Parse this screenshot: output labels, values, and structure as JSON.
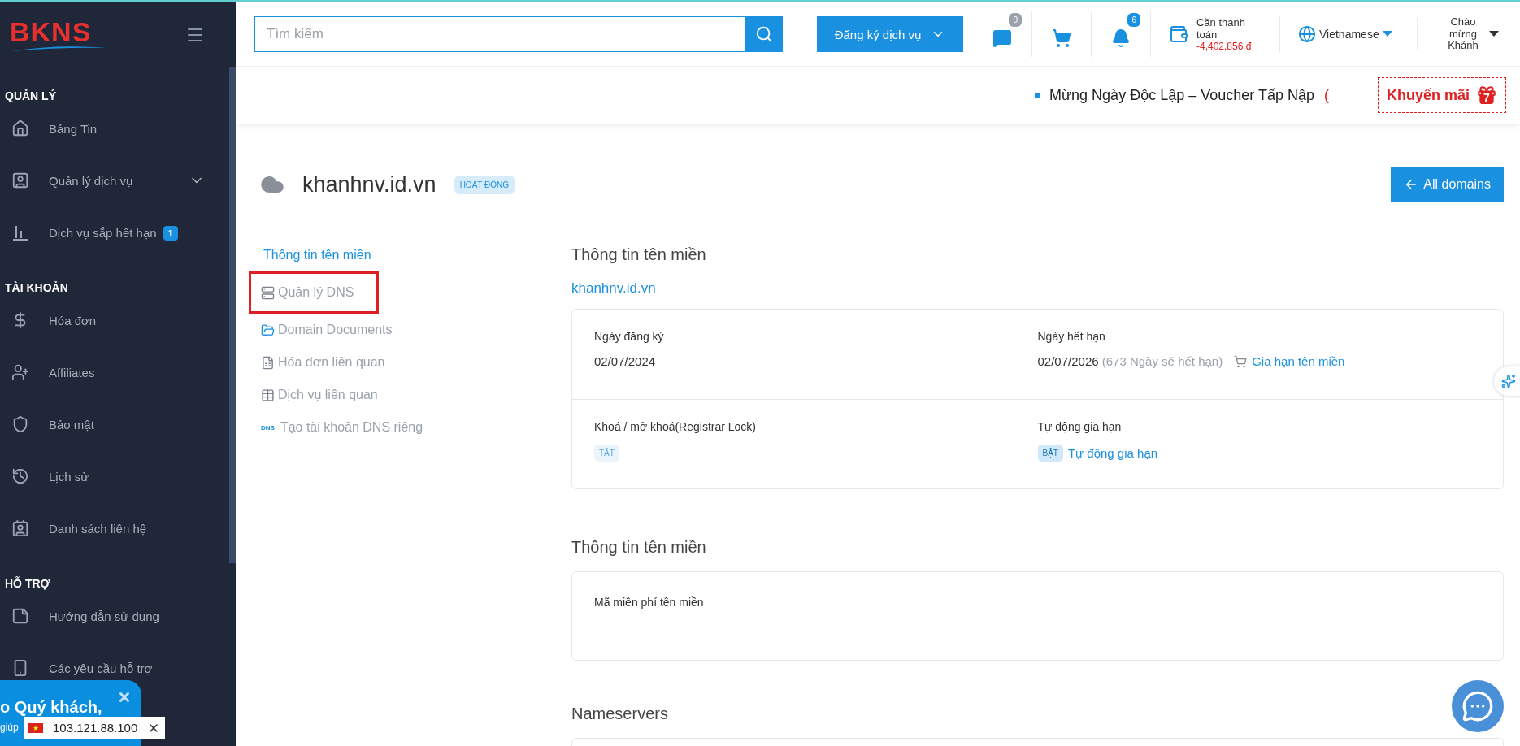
{
  "sidebar": {
    "logo": "BKNS",
    "sections": [
      {
        "title": "QUẢN LÝ",
        "items": [
          {
            "label": "Bảng Tin",
            "expandable": false
          },
          {
            "label": "Quản lý dịch vụ",
            "expandable": true
          },
          {
            "label": "Dịch vụ sắp hết hạn",
            "expandable": false,
            "badge": "1"
          }
        ]
      },
      {
        "title": "TÀI KHOẢN",
        "items": [
          {
            "label": "Hóa đơn",
            "expandable": false
          },
          {
            "label": "Affiliates",
            "expandable": false
          },
          {
            "label": "Bảo mật",
            "expandable": false
          },
          {
            "label": "Lịch sử",
            "expandable": false
          },
          {
            "label": "Danh sách liên hệ",
            "expandable": false
          }
        ]
      },
      {
        "title": "HỖ TRỢ",
        "items": [
          {
            "label": "Hướng dẫn sử dụng",
            "expandable": false
          },
          {
            "label": "Các yêu cầu hỗ trợ",
            "expandable": false
          }
        ]
      }
    ]
  },
  "header": {
    "search": {
      "placeholder": "Tìm kiếm"
    },
    "register_button": "Đăng ký dịch vụ",
    "messages_badge": "0",
    "notifications_badge": "6",
    "balance": {
      "label": "Cần thanh toán",
      "amount": "-4,402,856 đ"
    },
    "language": "Vietnamese",
    "user": "Chào mừng Khánh"
  },
  "promo_bar": {
    "ticker": "Mừng Ngày Độc Lập – Voucher Tấp Nập",
    "ticker_tail": "(",
    "promo_button": "Khuyến mãi",
    "promo_count": "7"
  },
  "domain": {
    "name": "khanhnv.id.vn",
    "status": "HOẠT ĐỘNG",
    "back_button": "All domains"
  },
  "domain_nav": [
    {
      "label": "Thông tin tên miền",
      "selected": true,
      "highlighted": false
    },
    {
      "label": "Quản lý DNS",
      "selected": false,
      "highlighted": true
    },
    {
      "label": "Domain Documents",
      "selected": false,
      "highlighted": false
    },
    {
      "label": "Hóa đơn liên quan",
      "selected": false,
      "highlighted": false
    },
    {
      "label": "Dịch vụ liên quan",
      "selected": false,
      "highlighted": false
    },
    {
      "label": "Tạo tài khoản DNS riêng",
      "selected": false,
      "highlighted": false,
      "icon_text": "DNS"
    }
  ],
  "info": {
    "title": "Thông tin tên miền",
    "domain_link": "khanhnv.id.vn",
    "registered": {
      "label": "Ngày đăng ký",
      "value": "02/07/2024"
    },
    "expires": {
      "label": "Ngày hết hạn",
      "value": "02/07/2026",
      "note": "(673 Ngày sẽ hết hạn)",
      "renew_link": "Gia hạn tên miền"
    },
    "lock": {
      "label": "Khoá / mở khoá(Registrar Lock)",
      "state": "TẮT",
      "on": false
    },
    "auto_renew": {
      "label": "Tự động gia hạn",
      "state": "BẬT",
      "on": true,
      "link": "Tự động gia hạn"
    }
  },
  "free_code": {
    "title": "Thông tin tên miền",
    "label": "Mã miễn phí tên miền"
  },
  "nameservers": {
    "title": "Nameservers"
  },
  "popup": {
    "greeting": "o Quý khách,",
    "text": "giúp",
    "ip": "103.121.88.100"
  }
}
